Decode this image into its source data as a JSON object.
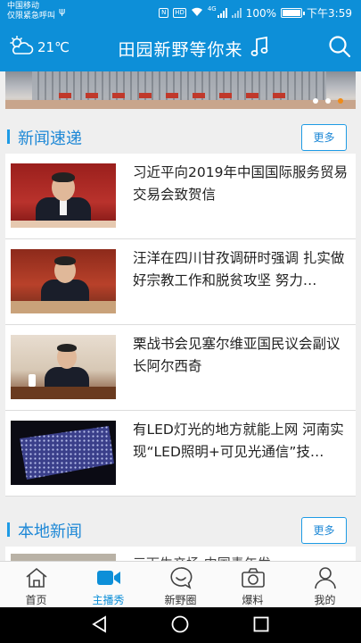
{
  "status_bar": {
    "carrier_line1": "中国移动",
    "carrier_line2": "仅限紧急呼叫",
    "usb_icon": "usb-icon",
    "battery": "100%",
    "time": "下午3:59",
    "network": "4G"
  },
  "header": {
    "weather_icon": "partly-cloudy-icon",
    "temperature": "21℃",
    "title": "田园新野等你来",
    "music_icon": "music-note-icon",
    "search_icon": "search-icon"
  },
  "banner": {
    "slide_count": 3,
    "active_slide": 3
  },
  "sections": {
    "news": {
      "title": "新闻速递",
      "more_label": "更多"
    },
    "local": {
      "title": "本地新闻",
      "more_label": "更多",
      "first_item_partial": "三下生产场 中国青年发"
    }
  },
  "news_items": [
    {
      "title": "习近平向2019年中国国际服务贸易交易会致贺信",
      "thumb": "leader-red-background"
    },
    {
      "title": "汪洋在四川甘孜调研时强调 扎实做好宗教工作和脱贫攻坚 努力…",
      "thumb": "speaker-at-desk"
    },
    {
      "title": "栗战书会见塞尔维亚国民议会副议长阿尔西奇",
      "thumb": "official-meeting"
    },
    {
      "title": "有LED灯光的地方就能上网 河南实现“LED照明+可见光通信”技…",
      "thumb": "led-panel"
    }
  ],
  "tabs": [
    {
      "label": "首页",
      "icon": "home-icon"
    },
    {
      "label": "主播秀",
      "icon": "video-camera-icon"
    },
    {
      "label": "新野圈",
      "icon": "chat-bubble-icon"
    },
    {
      "label": "爆料",
      "icon": "camera-icon"
    },
    {
      "label": "我的",
      "icon": "person-icon"
    }
  ],
  "active_tab": "主播秀",
  "colors": {
    "primary": "#0d8fd8",
    "accent": "#1e9be5",
    "banner_dot_active": "#f08b17"
  }
}
